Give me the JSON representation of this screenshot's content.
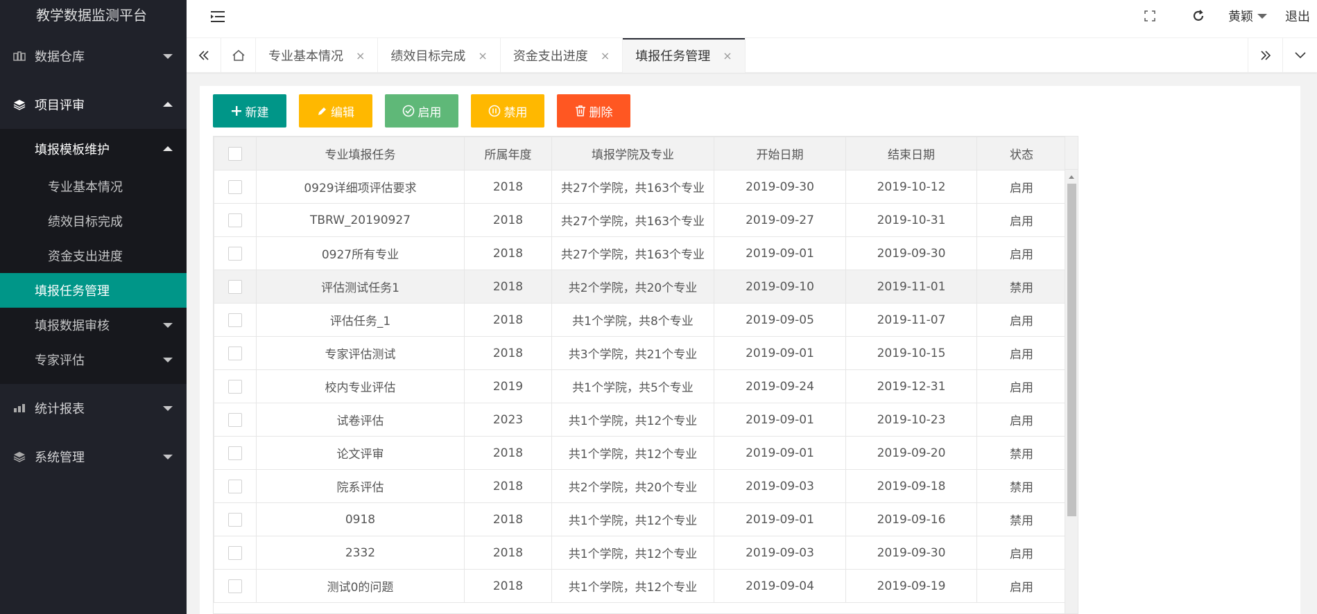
{
  "app": {
    "title": "教学数据监测平台"
  },
  "sidebar": {
    "items": [
      {
        "label": "数据仓库",
        "icon": "database-icon",
        "expanded": false
      },
      {
        "label": "项目评审",
        "icon": "layers-icon",
        "expanded": true
      },
      {
        "label": "统计报表",
        "icon": "chart-icon",
        "expanded": false
      },
      {
        "label": "系统管理",
        "icon": "layers-icon",
        "expanded": false
      }
    ],
    "review_children": {
      "template": {
        "label": "填报模板维护",
        "children": [
          "专业基本情况",
          "绩效目标完成",
          "资金支出进度"
        ]
      },
      "task": {
        "label": "填报任务管理"
      },
      "audit": {
        "label": "填报数据审核"
      },
      "expert": {
        "label": "专家评估"
      }
    }
  },
  "header": {
    "user": "黄颖",
    "logout": "退出"
  },
  "tabs": [
    {
      "label": "专业基本情况",
      "close": "×"
    },
    {
      "label": "绩效目标完成",
      "close": "×"
    },
    {
      "label": "资金支出进度",
      "close": "×"
    },
    {
      "label": "填报任务管理",
      "close": "×"
    }
  ],
  "toolbar": {
    "new": "新建",
    "edit": "编辑",
    "enable": "启用",
    "disable": "禁用",
    "delete": "删除"
  },
  "table": {
    "columns": [
      "专业填报任务",
      "所属年度",
      "填报学院及专业",
      "开始日期",
      "结束日期",
      "状态"
    ],
    "rows": [
      [
        "0929详细项评估要求",
        "2018",
        "共27个学院，共163个专业",
        "2019-09-30",
        "2019-10-12",
        "启用"
      ],
      [
        "TBRW_20190927",
        "2018",
        "共27个学院，共163个专业",
        "2019-09-27",
        "2019-10-31",
        "启用"
      ],
      [
        "0927所有专业",
        "2018",
        "共27个学院，共163个专业",
        "2019-09-01",
        "2019-09-30",
        "启用"
      ],
      [
        "评估测试任务1",
        "2018",
        "共2个学院，共20个专业",
        "2019-09-10",
        "2019-11-01",
        "禁用"
      ],
      [
        "评估任务_1",
        "2018",
        "共1个学院，共8个专业",
        "2019-09-05",
        "2019-11-07",
        "启用"
      ],
      [
        "专家评估测试",
        "2018",
        "共3个学院，共21个专业",
        "2019-09-01",
        "2019-10-15",
        "启用"
      ],
      [
        "校内专业评估",
        "2019",
        "共1个学院，共5个专业",
        "2019-09-24",
        "2019-12-31",
        "启用"
      ],
      [
        "试卷评估",
        "2023",
        "共1个学院，共12个专业",
        "2019-09-01",
        "2019-10-23",
        "启用"
      ],
      [
        "论文评审",
        "2018",
        "共1个学院，共12个专业",
        "2019-09-01",
        "2019-09-20",
        "禁用"
      ],
      [
        "院系评估",
        "2018",
        "共2个学院，共20个专业",
        "2019-09-03",
        "2019-09-18",
        "禁用"
      ],
      [
        "0918",
        "2018",
        "共1个学院，共12个专业",
        "2019-09-01",
        "2019-09-16",
        "禁用"
      ],
      [
        "2332",
        "2018",
        "共1个学院，共12个专业",
        "2019-09-03",
        "2019-09-30",
        "启用"
      ],
      [
        "测试0的问题",
        "2018",
        "共1个学院，共12个专业",
        "2019-09-04",
        "2019-09-19",
        "启用"
      ]
    ],
    "highlighted_row": 3
  },
  "colors": {
    "sidebar_bg": "#20222a",
    "active": "#009688",
    "warn": "#ffb800",
    "success": "#5fb878",
    "danger": "#ff5722"
  }
}
